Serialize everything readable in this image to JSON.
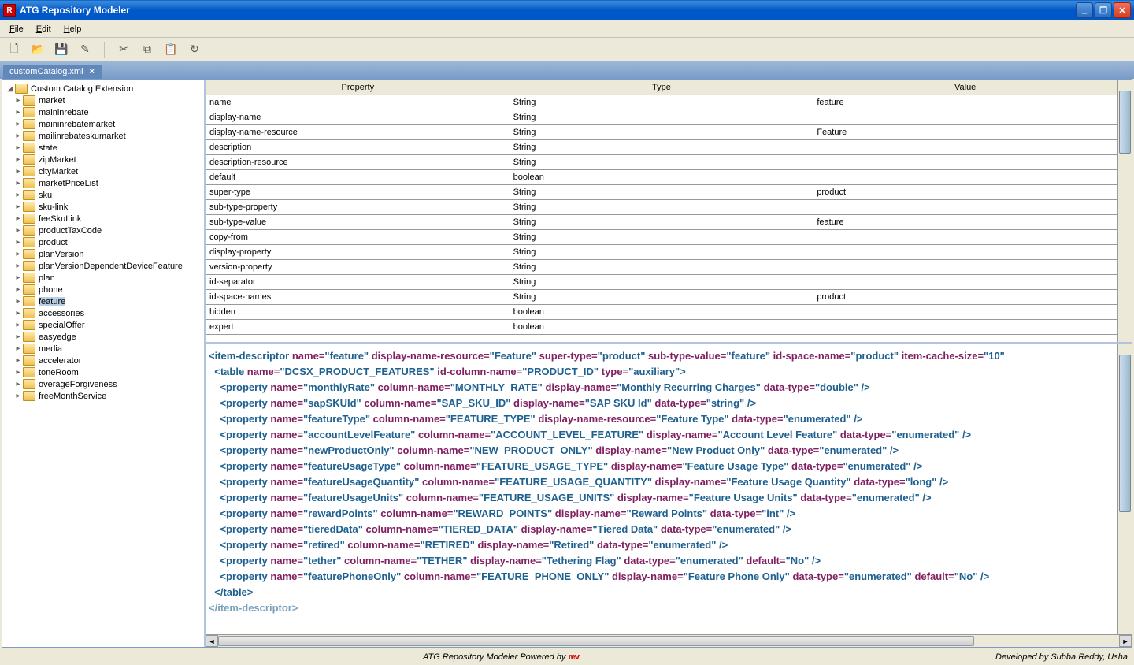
{
  "window": {
    "title": "ATG Repository Modeler"
  },
  "menu": {
    "file": "File",
    "edit": "Edit",
    "help": "Help"
  },
  "tab": {
    "label": "customCatalog.xml"
  },
  "tree": {
    "root": "Custom Catalog Extension",
    "items": [
      "market",
      "maininrebate",
      "maininrebatemarket",
      "mailinrebateskumarket",
      "state",
      "zipMarket",
      "cityMarket",
      "marketPriceList",
      "sku",
      "sku-link",
      "feeSkuLink",
      "productTaxCode",
      "product",
      "planVersion",
      "planVersionDependentDeviceFeature",
      "plan",
      "phone",
      "feature",
      "accessories",
      "specialOffer",
      "easyedge",
      "media",
      "accelerator",
      "toneRoom",
      "overageForgiveness",
      "freeMonthService"
    ],
    "selectedIndex": 17
  },
  "table": {
    "headers": [
      "Property",
      "Type",
      "Value"
    ],
    "rows": [
      {
        "p": "name",
        "t": "String",
        "v": "feature"
      },
      {
        "p": "display-name",
        "t": "String",
        "v": ""
      },
      {
        "p": "display-name-resource",
        "t": "String",
        "v": "Feature"
      },
      {
        "p": "description",
        "t": "String",
        "v": ""
      },
      {
        "p": "description-resource",
        "t": "String",
        "v": ""
      },
      {
        "p": "default",
        "t": "boolean",
        "v": ""
      },
      {
        "p": "super-type",
        "t": "String",
        "v": "product"
      },
      {
        "p": "sub-type-property",
        "t": "String",
        "v": ""
      },
      {
        "p": "sub-type-value",
        "t": "String",
        "v": "feature"
      },
      {
        "p": "copy-from",
        "t": "String",
        "v": ""
      },
      {
        "p": "display-property",
        "t": "String",
        "v": ""
      },
      {
        "p": "version-property",
        "t": "String",
        "v": ""
      },
      {
        "p": "id-separator",
        "t": "String",
        "v": ""
      },
      {
        "p": "id-space-names",
        "t": "String",
        "v": "product"
      },
      {
        "p": "hidden",
        "t": "boolean",
        "v": ""
      },
      {
        "p": "expert",
        "t": "boolean",
        "v": ""
      }
    ]
  },
  "xml": {
    "item": {
      "name": "feature",
      "dnr": "Feature",
      "st": "product",
      "stv": "feature",
      "isn": "product",
      "ics": "10"
    },
    "tableDef": {
      "name": "DCSX_PRODUCT_FEATURES",
      "idcol": "PRODUCT_ID",
      "type": "auxiliary"
    },
    "props": [
      {
        "name": "monthlyRate",
        "col": "MONTHLY_RATE",
        "dn": "Monthly Recurring Charges",
        "dt": "double"
      },
      {
        "name": "sapSKUId",
        "col": "SAP_SKU_ID",
        "dn": "SAP SKU Id",
        "dt": "string"
      },
      {
        "name": "featureType",
        "col": "FEATURE_TYPE",
        "dnr": "Feature Type",
        "dt": "enumerated"
      },
      {
        "name": "accountLevelFeature",
        "col": "ACCOUNT_LEVEL_FEATURE",
        "dn": "Account Level Feature",
        "dt": "enumerated"
      },
      {
        "name": "newProductOnly",
        "col": "NEW_PRODUCT_ONLY",
        "dn": "New Product Only",
        "dt": "enumerated"
      },
      {
        "name": "featureUsageType",
        "col": "FEATURE_USAGE_TYPE",
        "dn": "Feature Usage Type",
        "dt": "enumerated"
      },
      {
        "name": "featureUsageQuantity",
        "col": "FEATURE_USAGE_QUANTITY",
        "dn": "Feature Usage Quantity",
        "dt": "long"
      },
      {
        "name": "featureUsageUnits",
        "col": "FEATURE_USAGE_UNITS",
        "dn": "Feature Usage Units",
        "dt": "enumerated"
      },
      {
        "name": "rewardPoints",
        "col": "REWARD_POINTS",
        "dn": "Reward Points",
        "dt": "int"
      },
      {
        "name": "tieredData",
        "col": "TIERED_DATA",
        "dn": "Tiered Data",
        "dt": "enumerated"
      },
      {
        "name": "retired",
        "col": "RETIRED",
        "dn": "Retired",
        "dt": "enumerated"
      },
      {
        "name": "tether",
        "col": "TETHER",
        "dn": "Tethering Flag",
        "dt": "enumerated",
        "def": "No"
      },
      {
        "name": "featurePhoneOnly",
        "col": "FEATURE_PHONE_ONLY",
        "dn": "Feature Phone Only",
        "dt": "enumerated",
        "def": "No"
      }
    ]
  },
  "status": {
    "center": "ATG Repository Modeler Powered by ",
    "right": "Developed by Subba Reddy, Usha"
  }
}
